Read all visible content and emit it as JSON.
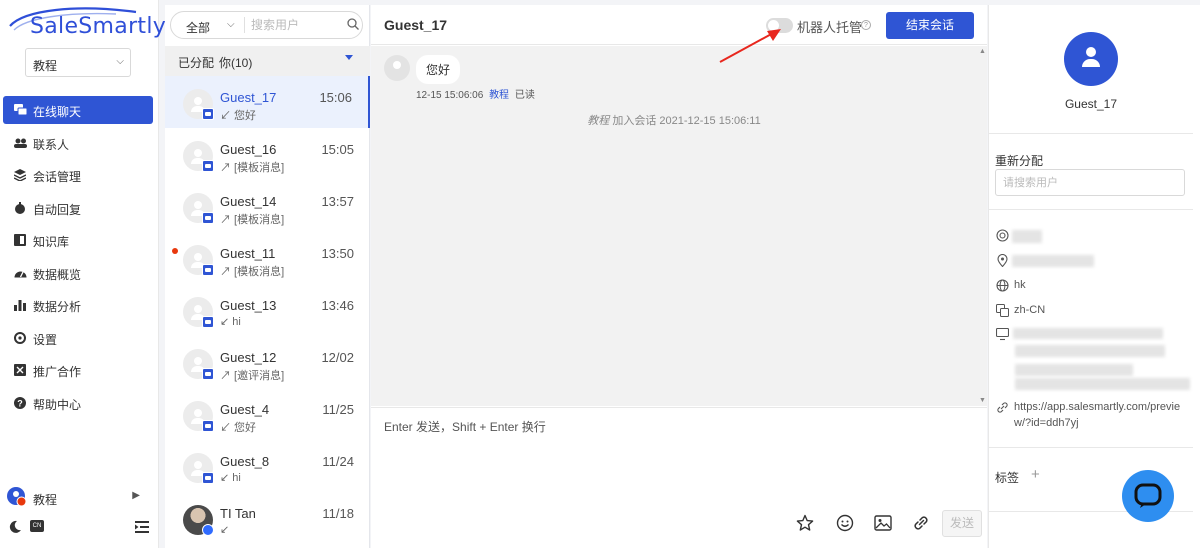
{
  "app": {
    "logo_text": "SaleSmartly",
    "workspace": "教程",
    "nav": [
      {
        "label": "在线聊天",
        "icon": "chat-icon",
        "active": true
      },
      {
        "label": "联系人",
        "icon": "contacts-icon"
      },
      {
        "label": "会话管理",
        "icon": "layers-icon"
      },
      {
        "label": "自动回复",
        "icon": "robot-icon"
      },
      {
        "label": "知识库",
        "icon": "book-icon"
      },
      {
        "label": "数据概览",
        "icon": "dashboard-icon"
      },
      {
        "label": "数据分析",
        "icon": "bar-chart-icon"
      },
      {
        "label": "设置",
        "icon": "gear-icon"
      },
      {
        "label": "推广合作",
        "icon": "share-icon"
      },
      {
        "label": "帮助中心",
        "icon": "help-icon"
      }
    ],
    "bottom_user": "教程",
    "lang_badge": "CN"
  },
  "list": {
    "filter": "全部",
    "search_placeholder": "搜索用户",
    "group_label": "已分配",
    "group_count": "你(10)",
    "conversations": [
      {
        "name": "Guest_17",
        "time": "15:06",
        "preview": "↙ 您好",
        "active": true
      },
      {
        "name": "Guest_16",
        "time": "15:05",
        "preview": "↗ [模板消息]"
      },
      {
        "name": "Guest_14",
        "time": "13:57",
        "preview": "↗ [模板消息]"
      },
      {
        "name": "Guest_11",
        "time": "13:50",
        "preview": "↗ [模板消息]",
        "unread": true
      },
      {
        "name": "Guest_13",
        "time": "13:46",
        "preview": "↙ hi"
      },
      {
        "name": "Guest_12",
        "time": "12/02",
        "preview": "↗ [邀评消息]"
      },
      {
        "name": "Guest_4",
        "time": "11/25",
        "preview": "↙ 您好"
      },
      {
        "name": "Guest_8",
        "time": "11/24",
        "preview": "↙ hi"
      },
      {
        "name": "TI Tan",
        "time": "11/18",
        "preview": "↙",
        "photo": true
      }
    ]
  },
  "chat": {
    "title": "Guest_17",
    "bot_label": "机器人托管",
    "bot_enabled": false,
    "end_button": "结束会话",
    "message_text": "您好",
    "message_time": "12-15 15:06:06",
    "message_agent": "教程",
    "message_status": "已读",
    "system_agent": "教程",
    "system_text": "加入会话 2021-12-15 15:06:11",
    "composer_placeholder": "Enter 发送，Shift + Enter 换行",
    "send_button": "发送"
  },
  "profile": {
    "name": "Guest_17",
    "reassign_label": "重新分配",
    "reassign_placeholder": "请搜索用户",
    "country": "hk",
    "language": "zh-CN",
    "url": "https://app.salesmartly.com/preview/?id=ddh7yj",
    "tags_label": "标签",
    "tags_add": "+"
  },
  "colors": {
    "primary": "#2f55d4",
    "fab": "#2e8ef0",
    "unread_dot": "#e8380d",
    "annotation": "#e8271e"
  }
}
